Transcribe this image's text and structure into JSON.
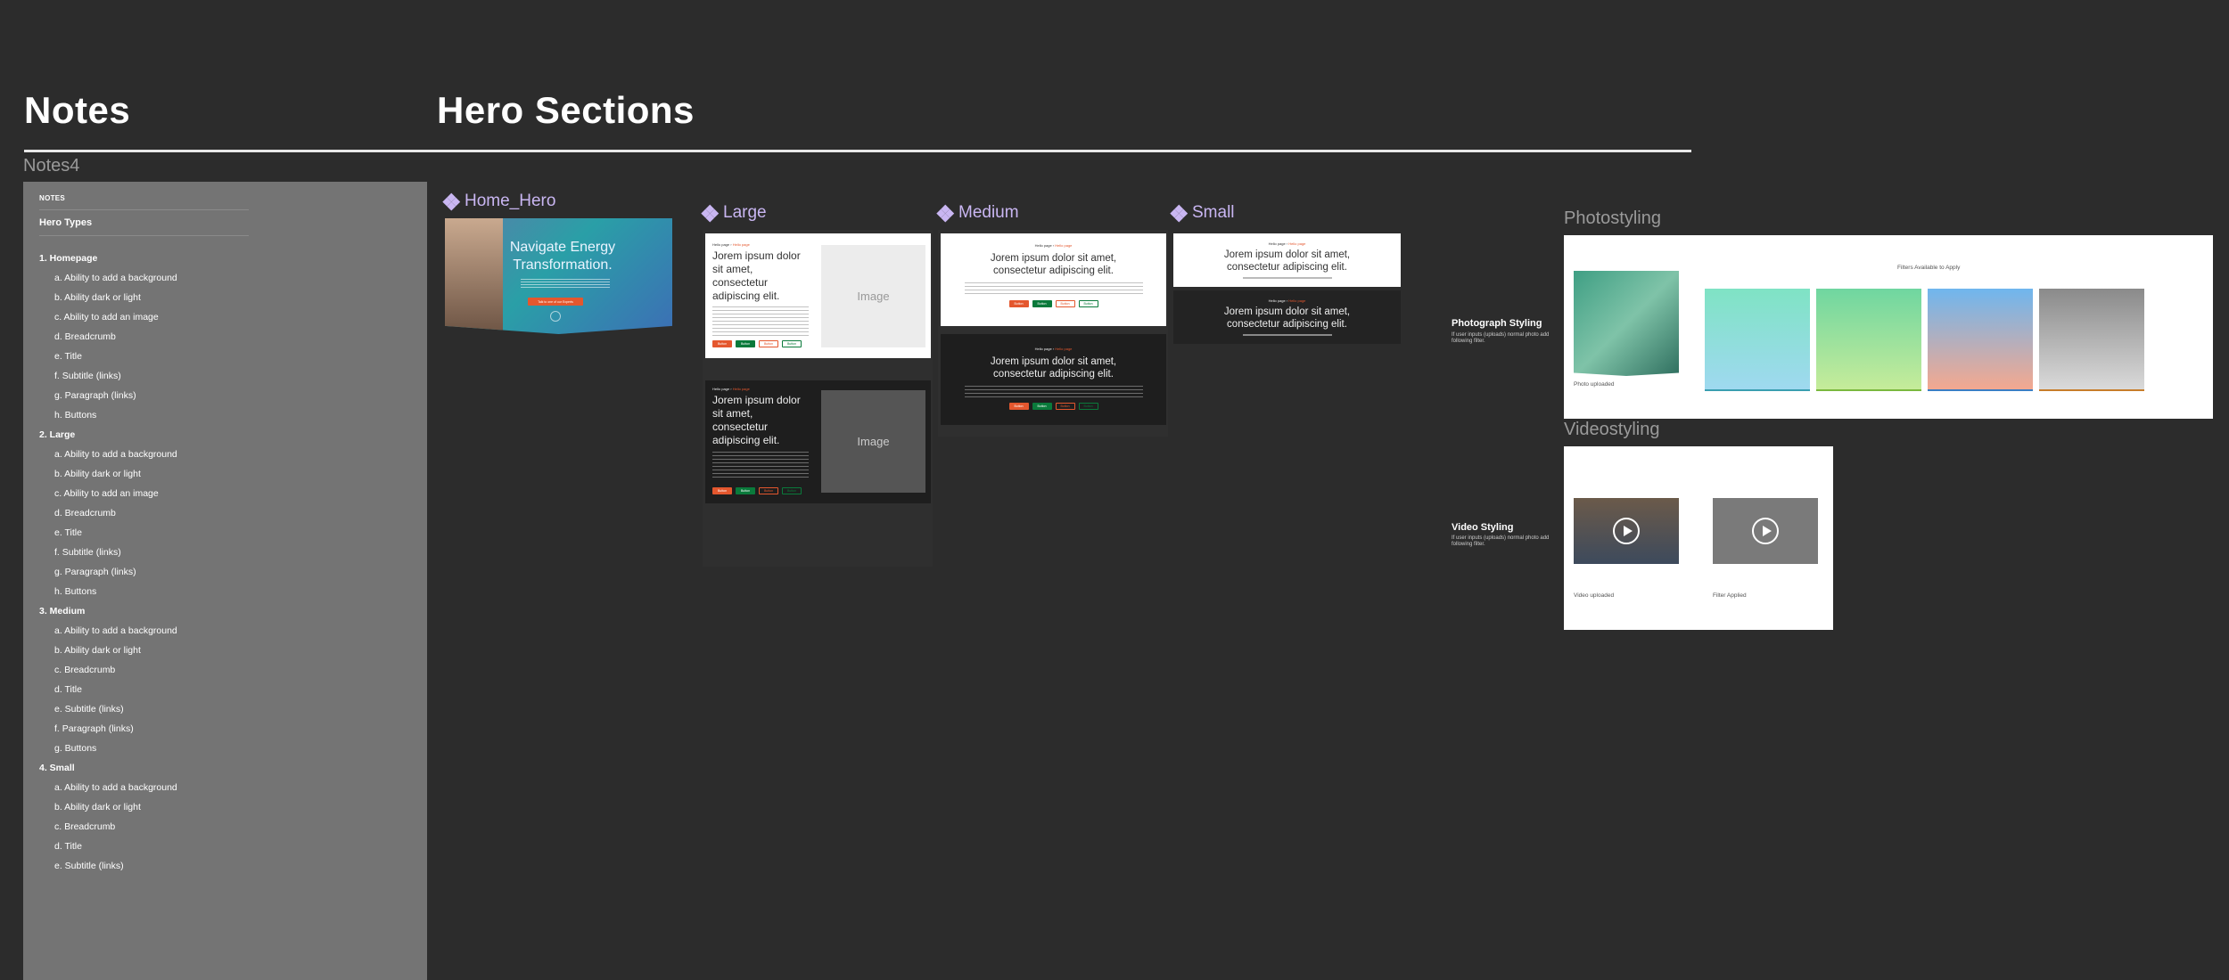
{
  "headings": {
    "notes": "Notes",
    "hero_sections": "Hero Sections"
  },
  "notes": {
    "frame_label": "Notes4",
    "caption": "NOTES",
    "heading": "Hero Types",
    "list": [
      {
        "kind": "h",
        "text": "1. Homepage"
      },
      {
        "kind": "i",
        "text": "a. Ability to add a background"
      },
      {
        "kind": "i",
        "text": "b. Ability dark or light"
      },
      {
        "kind": "i",
        "text": "c. Ability to add an image"
      },
      {
        "kind": "i",
        "text": "d. Breadcrumb"
      },
      {
        "kind": "i",
        "text": "e. Title"
      },
      {
        "kind": "i",
        "text": "f. Subtitle (links)"
      },
      {
        "kind": "i",
        "text": "g. Paragraph (links)"
      },
      {
        "kind": "i",
        "text": "h. Buttons"
      },
      {
        "kind": "h",
        "text": "2. Large"
      },
      {
        "kind": "i",
        "text": "a. Ability to add a background"
      },
      {
        "kind": "i",
        "text": "b. Ability dark or light"
      },
      {
        "kind": "i",
        "text": "c. Ability to add an image"
      },
      {
        "kind": "i",
        "text": "d. Breadcrumb"
      },
      {
        "kind": "i",
        "text": "e. Title"
      },
      {
        "kind": "i",
        "text": "f. Subtitle (links)"
      },
      {
        "kind": "i",
        "text": "g. Paragraph (links)"
      },
      {
        "kind": "i",
        "text": "h. Buttons"
      },
      {
        "kind": "h",
        "text": "3. Medium"
      },
      {
        "kind": "i",
        "text": "a. Ability to add a background"
      },
      {
        "kind": "i",
        "text": "b. Ability dark or light"
      },
      {
        "kind": "i",
        "text": "c. Breadcrumb"
      },
      {
        "kind": "i",
        "text": "d. Title"
      },
      {
        "kind": "i",
        "text": "e. Subtitle (links)"
      },
      {
        "kind": "i",
        "text": "f. Paragraph (links)"
      },
      {
        "kind": "i",
        "text": "g. Buttons"
      },
      {
        "kind": "h",
        "text": "4. Small"
      },
      {
        "kind": "i",
        "text": "a. Ability to add a background"
      },
      {
        "kind": "i",
        "text": "b. Ability dark or light"
      },
      {
        "kind": "i",
        "text": "c. Breadcrumb"
      },
      {
        "kind": "i",
        "text": "d. Title"
      },
      {
        "kind": "i",
        "text": "e. Subtitle (links)"
      }
    ]
  },
  "components": {
    "home_hero": {
      "label": "Home_Hero",
      "title": "Navigate Energy Transformation.",
      "cta": "Talk to one of our Experts"
    },
    "large": {
      "label": "Large",
      "title": "Jorem ipsum dolor sit amet, consectetur adipiscing elit.",
      "image": "Image"
    },
    "medium": {
      "label": "Medium",
      "title": "Jorem ipsum dolor sit amet, consectetur adipiscing elit."
    },
    "small": {
      "label": "Small",
      "title": "Jorem ipsum dolor sit amet, consectetur adipiscing elit."
    },
    "breadcrumb": {
      "home": "Hello page",
      "current": "Hello page"
    },
    "buttons": [
      "Button",
      "Button",
      "Button",
      "Button"
    ]
  },
  "photo": {
    "frame_label": "Photostyling",
    "side_title": "Photograph Styling",
    "side_desc": "If user inputs (uploads) normal photo add following filter.",
    "filters_caption": "Filters Available to Apply",
    "uploaded_caption": "Photo uploaded"
  },
  "video": {
    "frame_label": "Videostyling",
    "side_title": "Video Styling",
    "side_desc": "If user inputs (uploads) normal photo add following filter.",
    "uploaded_caption": "Video uploaded",
    "applied_caption": "Filter Applied"
  },
  "colors": {
    "accent_purple": "#c9b6f2",
    "button_orange": "#e4572e",
    "button_green": "#0a7a3b",
    "background": "#2c2c2c"
  }
}
